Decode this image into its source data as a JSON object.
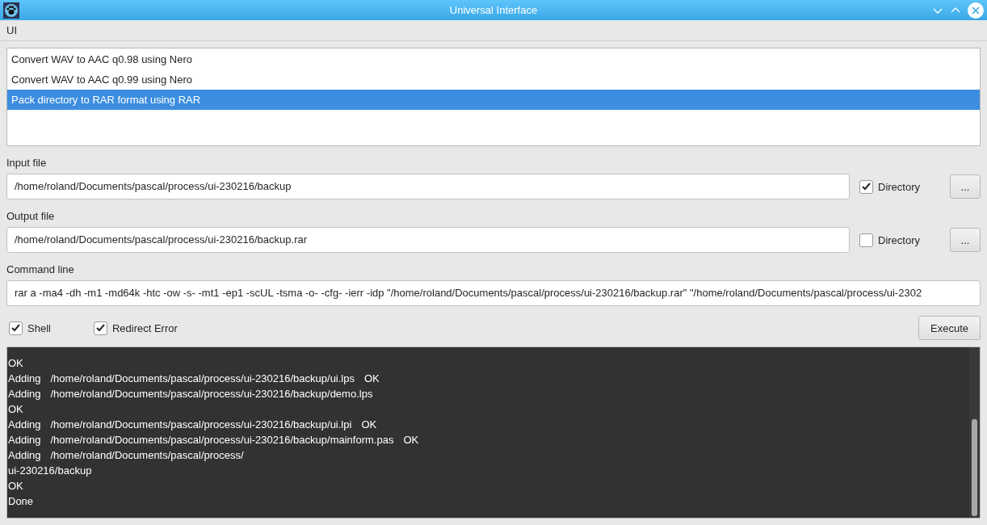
{
  "window": {
    "title": "Universal Interface"
  },
  "menu": [
    "UI"
  ],
  "presets": [
    {
      "label": "Convert WAV to AAC q0.98 using Nero",
      "selected": false
    },
    {
      "label": "Convert WAV to AAC q0.99 using Nero",
      "selected": false
    },
    {
      "label": "Pack directory to RAR format using RAR",
      "selected": true
    }
  ],
  "input": {
    "label": "Input file",
    "value": "/home/roland/Documents/pascal/process/ui-230216/backup",
    "directory": {
      "label": "Directory",
      "checked": true
    },
    "browse": "..."
  },
  "output": {
    "label": "Output file",
    "value": "/home/roland/Documents/pascal/process/ui-230216/backup.rar",
    "directory": {
      "label": "Directory",
      "checked": false
    },
    "browse": "..."
  },
  "command": {
    "label": "Command line",
    "value": "rar a -ma4 -dh -m1 -md64k -htc -ow -s- -mt1 -ep1 -scUL -tsma -o- -cfg- -ierr -idp \"/home/roland/Documents/pascal/process/ui-230216/backup.rar\" \"/home/roland/Documents/pascal/process/ui-2302"
  },
  "options": [
    {
      "label": "Shell",
      "checked": true
    },
    {
      "label": "Redirect Error",
      "checked": true
    }
  ],
  "execute": "Execute",
  "console": [
    [
      "OK"
    ],
    [
      "Adding",
      "/home/roland/Documents/pascal/process/ui-230216/backup/ui.lps",
      "OK"
    ],
    [
      "Adding",
      "/home/roland/Documents/pascal/process/ui-230216/backup/demo.lps"
    ],
    [
      "OK"
    ],
    [
      "Adding",
      "/home/roland/Documents/pascal/process/ui-230216/backup/ui.lpi",
      "OK"
    ],
    [
      "Adding",
      "/home/roland/Documents/pascal/process/ui-230216/backup/mainform.pas",
      "OK"
    ],
    [
      "Adding",
      "/home/roland/Documents/pascal/process/"
    ],
    [
      "ui-230216/backup"
    ],
    [
      "OK"
    ],
    [
      "Done"
    ]
  ]
}
